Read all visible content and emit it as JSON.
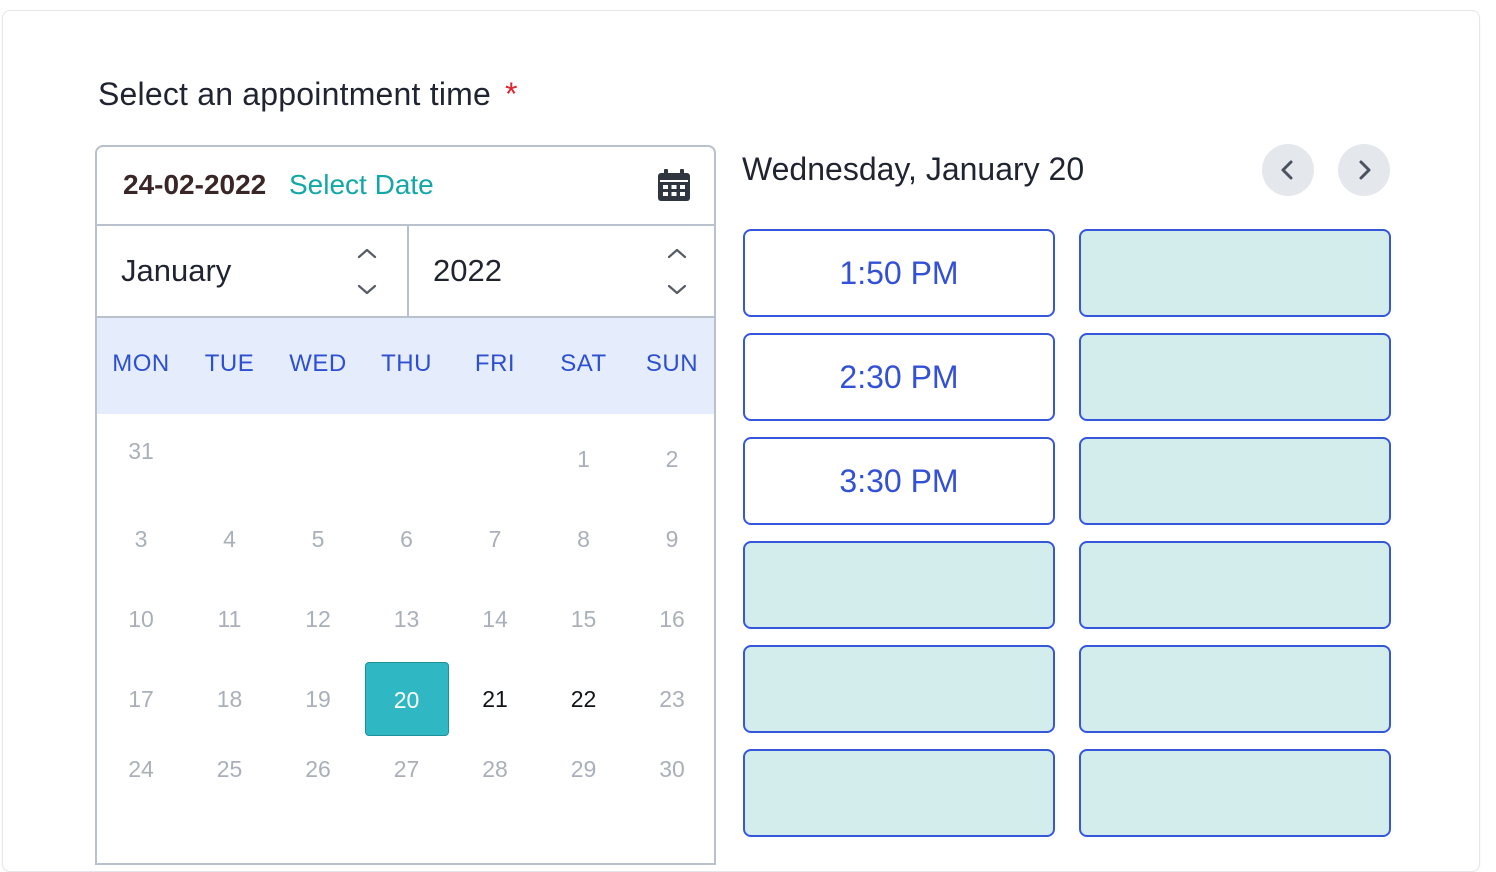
{
  "form": {
    "title": "Select an appointment time",
    "required_marker": "*"
  },
  "calendar": {
    "date_value": "24-02-2022",
    "select_date_label": "Select Date",
    "month": "January",
    "year": "2022",
    "weekdays": [
      "MON",
      "TUE",
      "WED",
      "THU",
      "FRI",
      "SAT",
      "SUN"
    ],
    "days": [
      "1",
      "2",
      "3",
      "4",
      "5",
      "6",
      "7",
      "8",
      "9",
      "10",
      "11",
      "12",
      "13",
      "14",
      "15",
      "16",
      "17",
      "18",
      "19",
      "20",
      "21",
      "22",
      "23",
      "24",
      "25",
      "26",
      "27",
      "28",
      "29",
      "30",
      "31"
    ],
    "selected_day": "20",
    "available_days": [
      "21",
      "22"
    ],
    "colors": {
      "selected_bg": "#2fb8c3",
      "header_bg": "#e5edfd",
      "accent": "#14a7a7"
    }
  },
  "schedule": {
    "date_heading": "Wednesday, January 20",
    "prev_icon": "chevron-left-icon",
    "next_icon": "chevron-right-icon",
    "slots_left": [
      "1:50 PM",
      "2:30 PM",
      "3:30 PM",
      "",
      "",
      ""
    ],
    "slots_right": [
      "",
      "",
      "",
      "",
      "",
      ""
    ],
    "colors": {
      "slot_border": "#3656dc",
      "slot_empty_bg": "#d3ecec"
    }
  }
}
